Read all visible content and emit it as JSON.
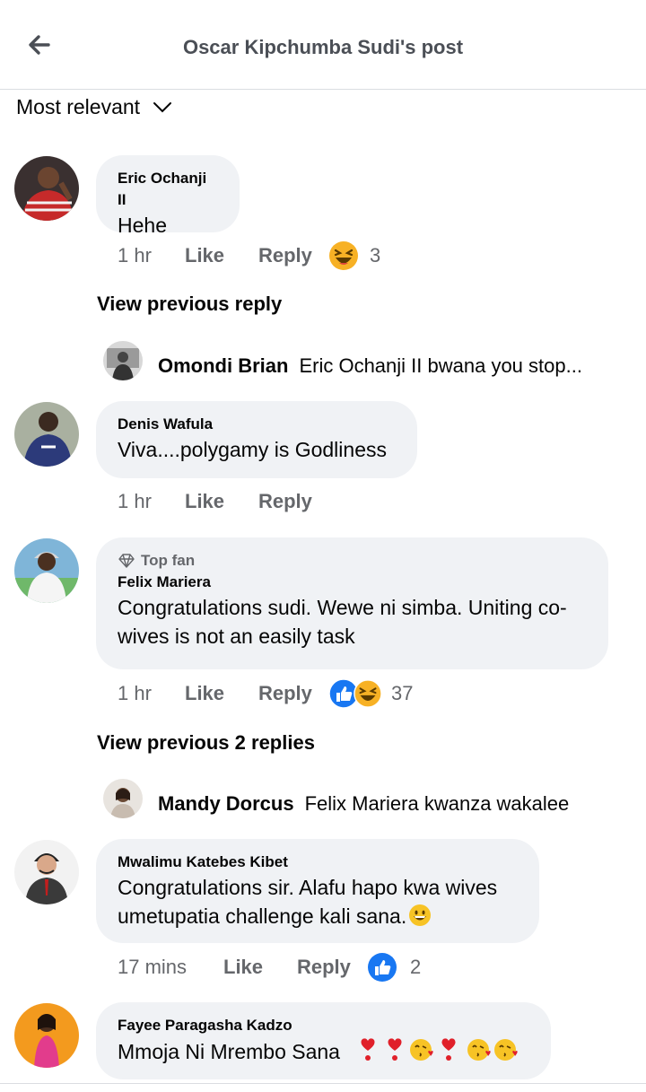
{
  "header": {
    "title": "Oscar Kipchumba Sudi's post"
  },
  "sort": {
    "label": "Most relevant"
  },
  "colors": {
    "like_blue": "#1877f2",
    "haha_yellow": "#f7b125",
    "bubble_bg": "#f0f2f5",
    "meta_gray": "#65676b"
  },
  "comments": [
    {
      "name": "Eric Ochanji II",
      "text": "Hehe",
      "time": "1 hr",
      "like": "Like",
      "reply": "Reply",
      "reactions": [
        "haha-icon"
      ],
      "reaction_count": "3"
    },
    {
      "name": "Denis Wafula",
      "text": "Viva....polygamy is Godliness",
      "time": "1 hr",
      "like": "Like",
      "reply": "Reply"
    },
    {
      "badge": "Top fan",
      "name": "Felix Mariera",
      "text": "Congratulations sudi. Wewe ni simba. Uniting co-wives is not an easily task",
      "time": "1 hr",
      "like": "Like",
      "reply": "Reply",
      "reactions": [
        "like-icon",
        "haha-icon"
      ],
      "reaction_count": "37"
    },
    {
      "name": "Mwalimu Katebes Kibet",
      "text": "Congratulations sir. Alafu hapo kwa wives umetupatia challenge kali sana.",
      "text_emoji": "grinning-face-emoji",
      "time": "17 mins",
      "like": "Like",
      "reply": "Reply",
      "reactions": [
        "like-icon"
      ],
      "reaction_count": "2"
    },
    {
      "name": "Fayee Paragasha Kadzo",
      "text": "Mmoja Ni Mrembo Sana",
      "text_emojis": [
        "heart-exclamation",
        "heart-exclamation",
        "kissing-face",
        "heart-exclamation",
        "kissing-face",
        "kissing-face"
      ]
    }
  ],
  "threads": [
    {
      "view_prev": "View previous reply",
      "reply_name": "Omondi Brian",
      "reply_text": "Eric Ochanji II bwana you stop..."
    },
    {
      "view_prev": "View previous 2 replies",
      "reply_name": "Mandy Dorcus",
      "reply_text": "Felix Mariera kwanza wakalee"
    }
  ]
}
